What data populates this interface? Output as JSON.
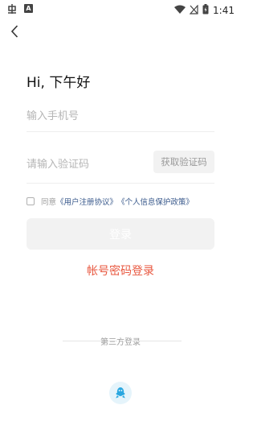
{
  "status_bar": {
    "time": "1:41",
    "notification_badge": "A"
  },
  "header": {
    "back_icon": "chevron-left-icon"
  },
  "greeting": "Hi, 下午好",
  "phone_field": {
    "placeholder": "输入手机号",
    "value": ""
  },
  "code_field": {
    "placeholder": "请输入验证码",
    "value": ""
  },
  "get_code_button": "获取验证码",
  "agreement": {
    "prefix": "同意",
    "user_agreement": "《用户注册协议》",
    "privacy_policy": "《个人信息保护政策》",
    "checked": false
  },
  "login_button": "登录",
  "password_login_link": "帐号密码登录",
  "third_party": {
    "label": "第三方登录",
    "providers": [
      "qq-icon"
    ]
  },
  "colors": {
    "accent": "#e8573f",
    "link": "#3a5a8c",
    "qq_icon": "#2aa7e0",
    "qq_bg": "#e5f4fb"
  }
}
